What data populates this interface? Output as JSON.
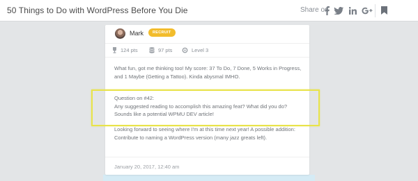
{
  "header": {
    "title": "50 Things to Do with WordPress Before You Die",
    "share_label": "Share on",
    "share_icons": [
      "facebook-icon",
      "twitter-icon",
      "linkedin-icon",
      "google-plus-icon"
    ],
    "bookmark_icon": "bookmark-icon"
  },
  "comment": {
    "author": "Mark",
    "rank": "RECRUIT",
    "stats": {
      "points": "124 pts",
      "reputation": "97 pts",
      "level": "Level 3"
    },
    "paragraphs": [
      {
        "lines": [
          "What fun, got me thinking too! My score: 37 To Do, 7 Done, 5 Works in Progress,",
          "and 1 Maybe (Getting a Tattoo). Kinda abysmal IMHO."
        ]
      },
      {
        "lines": [
          "Question on #42:",
          "Any suggested reading to accomplish this amazing feat? What did you do?",
          "Sounds like a potential WPMU DEV article!"
        ]
      },
      {
        "lines": [
          "Looking forward to seeing where I'm at this time next year! A possible addition:",
          "Contribute to naming a WordPress version (many jazz greats left)."
        ]
      }
    ],
    "timestamp": "January 20, 2017, 12:40 am"
  },
  "colors": {
    "badge": "#f2bc2c",
    "highlight": "#e8e34a",
    "background": "#e4e6e8",
    "card": "#ffffff"
  }
}
